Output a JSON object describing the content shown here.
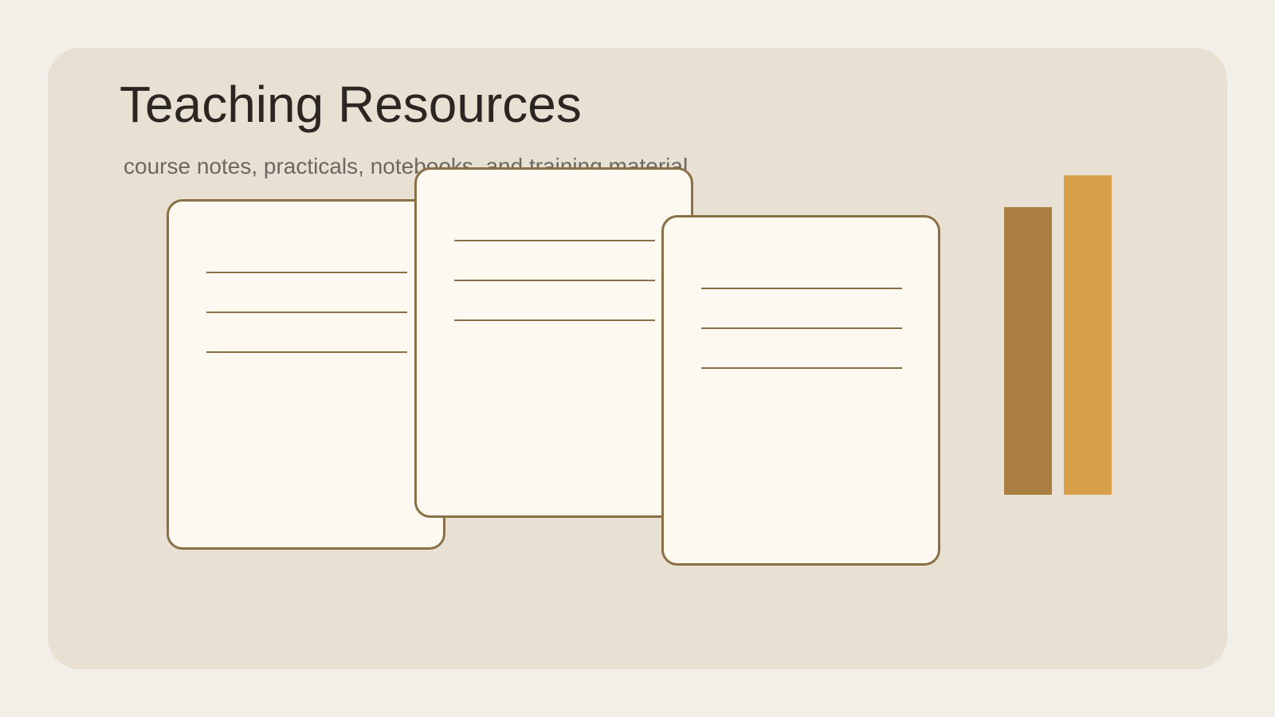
{
  "header": {
    "title": "Teaching Resources",
    "subtitle": "course notes, practicals, notebooks, and training material"
  },
  "illustration": {
    "documents": [
      {
        "icon": "lined-page-icon",
        "lines": 3
      },
      {
        "icon": "lined-page-icon",
        "lines": 3
      },
      {
        "icon": "lined-page-icon",
        "lines": 3
      }
    ],
    "books": [
      {
        "icon": "book-spine-icon",
        "color": "#ab7f41"
      },
      {
        "icon": "book-spine-icon",
        "color": "#d7a049"
      }
    ]
  },
  "colors": {
    "background": "#f2efe8",
    "panel": "#e8e0d2",
    "page_fill": "#fdf9f1",
    "page_stroke": "#8b6f47",
    "title_text": "#2b2622",
    "subtitle_text": "#6e6660"
  }
}
